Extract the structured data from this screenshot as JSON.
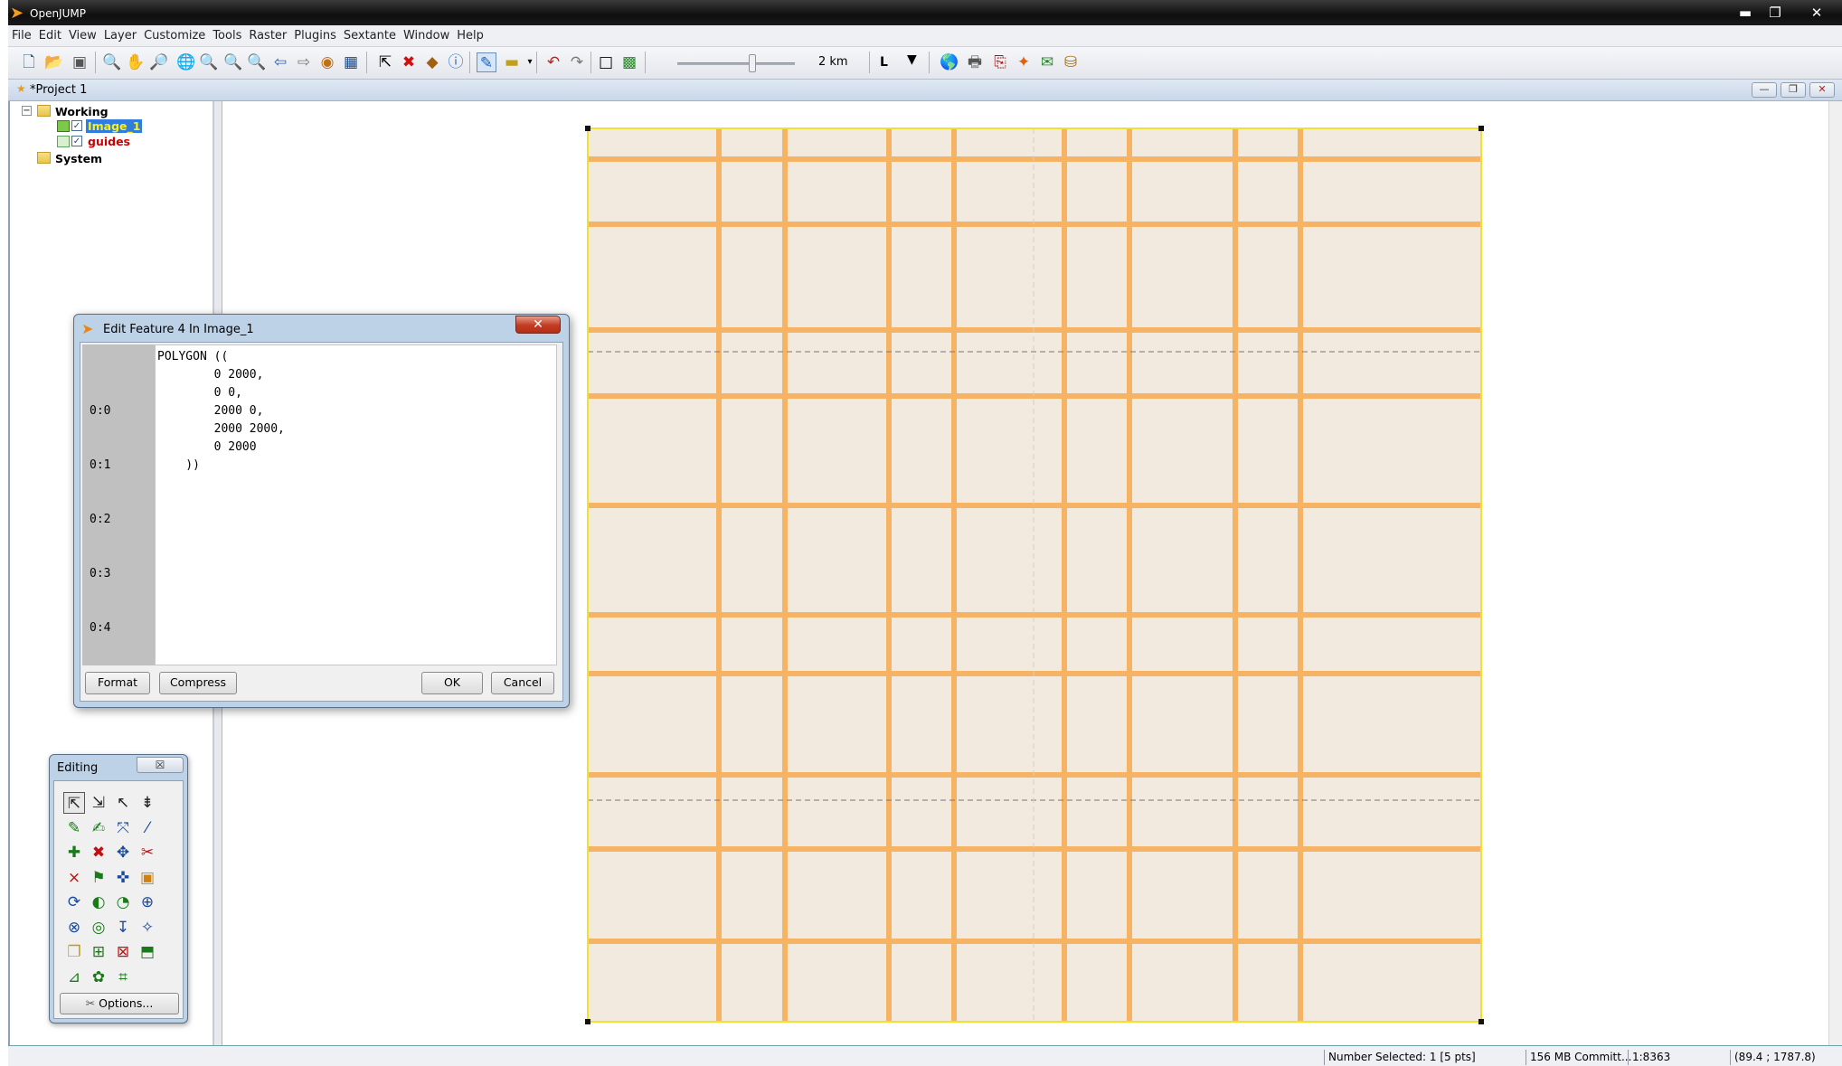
{
  "window": {
    "title": "OpenJUMP",
    "controls": {
      "minimize": "▬",
      "restore": "❐",
      "close": "✕"
    }
  },
  "menu": [
    "File",
    "Edit",
    "View",
    "Layer",
    "Customize",
    "Tools",
    "Raster",
    "Plugins",
    "Sextante",
    "Window",
    "Help"
  ],
  "toolbar": {
    "scale_label": "2 km",
    "layer_selector": "L",
    "icons": [
      "new-project",
      "open",
      "save",
      "zoom-area",
      "pan",
      "zoom-realtime",
      "zoom-full-extent",
      "zoom-in",
      "zoom-out",
      "zoom-to-selected",
      "zoom-previous",
      "zoom-next",
      "zoom-to-fence",
      "zoom-to-grid",
      "select",
      "delete",
      "copy-to-layer",
      "info",
      "edit-toggle",
      "measure",
      "undo",
      "redo",
      "fence",
      "wms",
      "add-datastore",
      "print",
      "export",
      "style",
      "wfs",
      "database"
    ]
  },
  "project": {
    "title": "*Project 1",
    "controls": {
      "minimize": "—",
      "restore": "❐",
      "close": "✕"
    }
  },
  "layer_tree": {
    "groups": [
      {
        "name": "Working",
        "layers": [
          {
            "name": "Image_1",
            "checked": true,
            "selected": true,
            "color": "#20a020"
          },
          {
            "name": "guides",
            "checked": true,
            "selected": false,
            "color": "#cc0000"
          }
        ]
      },
      {
        "name": "System",
        "layers": []
      }
    ]
  },
  "dialog": {
    "title": "Edit Feature 4 In Image_1",
    "line_numbers": [
      "0:0",
      "0:1",
      "0:2",
      "0:3",
      "0:4"
    ],
    "wkt": "POLYGON ((\n        0 2000,\n        0 0,\n        2000 0,\n        2000 2000,\n        0 2000\n    ))",
    "buttons": {
      "format": "Format",
      "compress": "Compress",
      "ok": "OK",
      "cancel": "Cancel"
    },
    "close": "✕"
  },
  "editing_toolbox": {
    "title": "Editing",
    "close": "☒",
    "options_label": "Options...",
    "tool_icons": [
      "select-features",
      "select-parts",
      "select-linestrings",
      "select-multiple",
      "draw-polygon",
      "draw-rectangle",
      "snap",
      "draw-line",
      "add-vertex",
      "delete-vertex",
      "move-vertex",
      "split",
      "cut",
      "merge",
      "move",
      "rotate",
      "scale",
      "rotate-handle",
      "buffer",
      "union",
      "intersect",
      "difference",
      "measure",
      "copy",
      "paste",
      "vertex-mode",
      "extract",
      "note",
      "layer-edit",
      "crop",
      "grid"
    ]
  },
  "map": {
    "background_color": "#f2e9df",
    "line_color": "#f7b364",
    "frame_color": "#f0e130",
    "guide_color": "#777777"
  },
  "status": {
    "selection": "Number Selected: 1 [5 pts]",
    "memory": "156 MB Committ...",
    "scale": "1:8363",
    "coords": "(89.4 ; 1787.8)"
  }
}
